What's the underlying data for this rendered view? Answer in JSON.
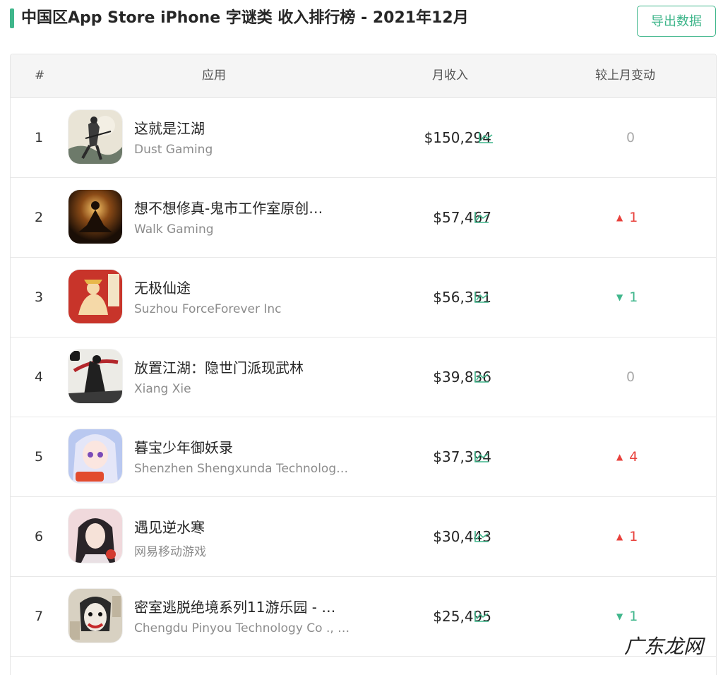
{
  "header": {
    "title": "中国区App Store iPhone 字谜类 收入排行榜 - 2021年12月",
    "export_label": "导出数据"
  },
  "table": {
    "columns": [
      "#",
      "应用",
      "月收入",
      "较上月变动"
    ],
    "rows": [
      {
        "rank": "1",
        "name": "这就是江湖",
        "developer": "Dust Gaming",
        "revenue": "$150,294",
        "change": "0",
        "direction": "same",
        "icon": "app-icon-swordsman-ink"
      },
      {
        "rank": "2",
        "name": "想不想修真-鬼市工作室原创…",
        "developer": "Walk Gaming",
        "revenue": "$57,467",
        "change": "1",
        "direction": "up",
        "icon": "app-icon-meditating-figure"
      },
      {
        "rank": "3",
        "name": "无极仙途",
        "developer": "Suzhou ForceForever Inc",
        "revenue": "$56,351",
        "change": "1",
        "direction": "down",
        "icon": "app-icon-immortal-red"
      },
      {
        "rank": "4",
        "name": "放置江湖：隐世门派现武林",
        "developer": "Xiang Xie",
        "revenue": "$39,836",
        "change": "0",
        "direction": "same",
        "icon": "app-icon-ink-warrior"
      },
      {
        "rank": "5",
        "name": "暮宝少年御妖录",
        "developer": "Shenzhen Shengxunda Technolog…",
        "revenue": "$37,394",
        "change": "4",
        "direction": "up",
        "icon": "app-icon-anime-girl"
      },
      {
        "rank": "6",
        "name": "遇见逆水寒",
        "developer": "网易移动游戏",
        "revenue": "$30,443",
        "change": "1",
        "direction": "up",
        "icon": "app-icon-anime-man"
      },
      {
        "rank": "7",
        "name": "密室逃脱绝境系列11游乐园 - …",
        "developer": "Chengdu Pinyou Technology Co ., …",
        "revenue": "$25,495",
        "change": "1",
        "direction": "down",
        "icon": "app-icon-clown"
      }
    ]
  },
  "watermark": "广东龙网",
  "colors": {
    "accent": "#3fb68b",
    "up": "#e8413c",
    "down": "#3fb68b",
    "neutral": "#aaaaaa"
  }
}
